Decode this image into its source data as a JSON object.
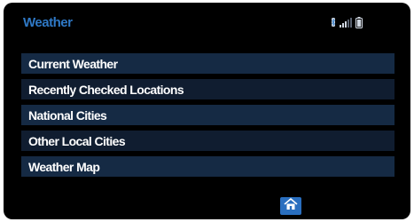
{
  "app": {
    "title": "Weather"
  },
  "status_bar": {
    "icons": [
      "bluetooth-icon",
      "signal-strength-icon",
      "battery-icon"
    ]
  },
  "menu": {
    "items": [
      {
        "label": "Current Weather"
      },
      {
        "label": "Recently Checked Locations"
      },
      {
        "label": "National Cities"
      },
      {
        "label": "Other Local Cities"
      },
      {
        "label": "Weather Map"
      }
    ]
  },
  "footer": {
    "icon": "home-icon"
  },
  "colors": {
    "background": "#000000",
    "title": "#2f79c6",
    "menu_row": "#152a44",
    "menu_row_alt": "#101d30",
    "home_button": "#2a6fbf"
  }
}
